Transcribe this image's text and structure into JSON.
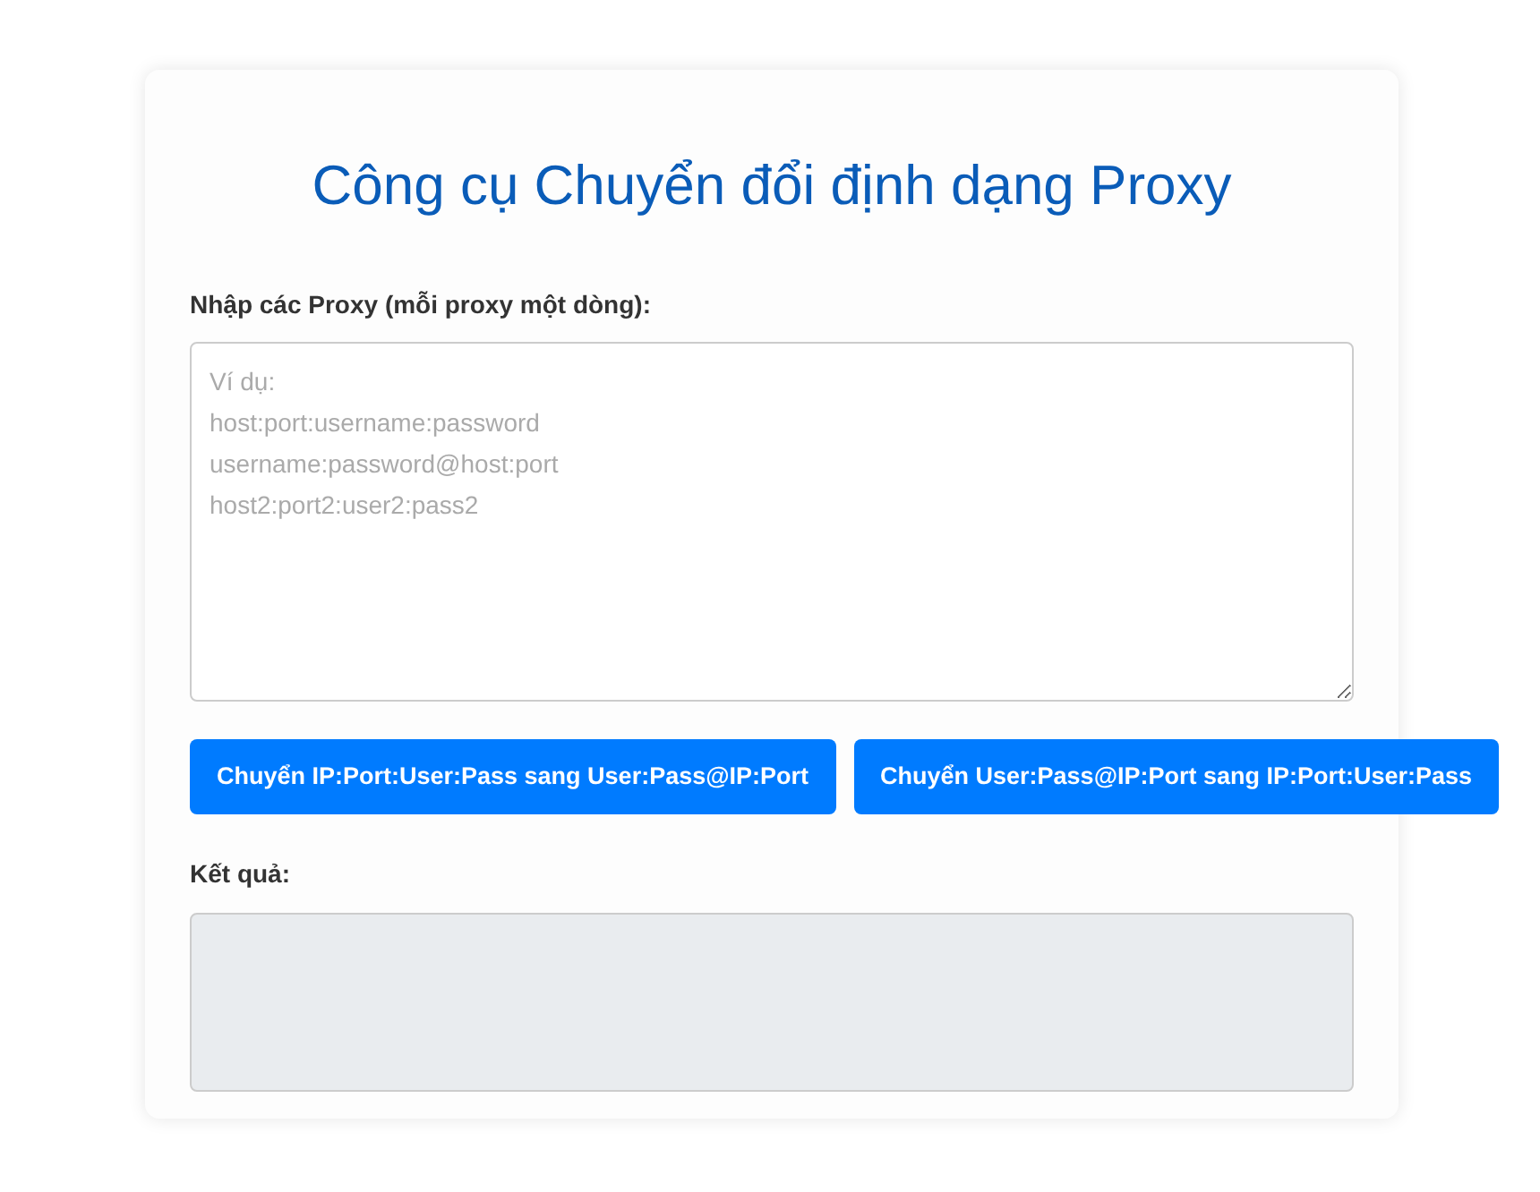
{
  "title": "Công cụ Chuyển đổi định dạng Proxy",
  "input": {
    "label": "Nhập các Proxy (mỗi proxy một dòng):",
    "placeholder": "Ví dụ:\nhost:port:username:password\nusername:password@host:port\nhost2:port2:user2:pass2"
  },
  "buttons": [
    "Chuyển IP:Port:User:Pass sang User:Pass@IP:Port",
    "Chuyển User:Pass@IP:Port sang IP:Port:User:Pass"
  ],
  "result": {
    "label": "Kết quả:",
    "readonly": true
  }
}
